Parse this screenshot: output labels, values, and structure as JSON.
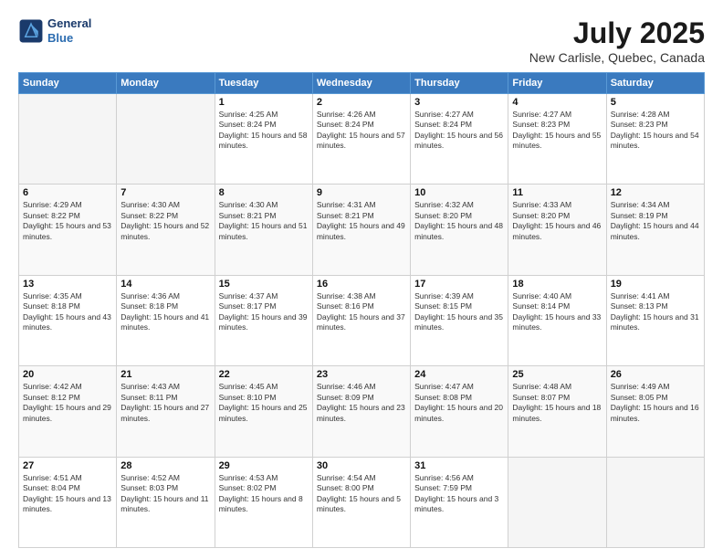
{
  "header": {
    "logo_line1": "General",
    "logo_line2": "Blue",
    "title": "July 2025",
    "subtitle": "New Carlisle, Quebec, Canada"
  },
  "weekdays": [
    "Sunday",
    "Monday",
    "Tuesday",
    "Wednesday",
    "Thursday",
    "Friday",
    "Saturday"
  ],
  "weeks": [
    [
      {
        "day": "",
        "info": ""
      },
      {
        "day": "",
        "info": ""
      },
      {
        "day": "1",
        "info": "Sunrise: 4:25 AM\nSunset: 8:24 PM\nDaylight: 15 hours and 58 minutes."
      },
      {
        "day": "2",
        "info": "Sunrise: 4:26 AM\nSunset: 8:24 PM\nDaylight: 15 hours and 57 minutes."
      },
      {
        "day": "3",
        "info": "Sunrise: 4:27 AM\nSunset: 8:24 PM\nDaylight: 15 hours and 56 minutes."
      },
      {
        "day": "4",
        "info": "Sunrise: 4:27 AM\nSunset: 8:23 PM\nDaylight: 15 hours and 55 minutes."
      },
      {
        "day": "5",
        "info": "Sunrise: 4:28 AM\nSunset: 8:23 PM\nDaylight: 15 hours and 54 minutes."
      }
    ],
    [
      {
        "day": "6",
        "info": "Sunrise: 4:29 AM\nSunset: 8:22 PM\nDaylight: 15 hours and 53 minutes."
      },
      {
        "day": "7",
        "info": "Sunrise: 4:30 AM\nSunset: 8:22 PM\nDaylight: 15 hours and 52 minutes."
      },
      {
        "day": "8",
        "info": "Sunrise: 4:30 AM\nSunset: 8:21 PM\nDaylight: 15 hours and 51 minutes."
      },
      {
        "day": "9",
        "info": "Sunrise: 4:31 AM\nSunset: 8:21 PM\nDaylight: 15 hours and 49 minutes."
      },
      {
        "day": "10",
        "info": "Sunrise: 4:32 AM\nSunset: 8:20 PM\nDaylight: 15 hours and 48 minutes."
      },
      {
        "day": "11",
        "info": "Sunrise: 4:33 AM\nSunset: 8:20 PM\nDaylight: 15 hours and 46 minutes."
      },
      {
        "day": "12",
        "info": "Sunrise: 4:34 AM\nSunset: 8:19 PM\nDaylight: 15 hours and 44 minutes."
      }
    ],
    [
      {
        "day": "13",
        "info": "Sunrise: 4:35 AM\nSunset: 8:18 PM\nDaylight: 15 hours and 43 minutes."
      },
      {
        "day": "14",
        "info": "Sunrise: 4:36 AM\nSunset: 8:18 PM\nDaylight: 15 hours and 41 minutes."
      },
      {
        "day": "15",
        "info": "Sunrise: 4:37 AM\nSunset: 8:17 PM\nDaylight: 15 hours and 39 minutes."
      },
      {
        "day": "16",
        "info": "Sunrise: 4:38 AM\nSunset: 8:16 PM\nDaylight: 15 hours and 37 minutes."
      },
      {
        "day": "17",
        "info": "Sunrise: 4:39 AM\nSunset: 8:15 PM\nDaylight: 15 hours and 35 minutes."
      },
      {
        "day": "18",
        "info": "Sunrise: 4:40 AM\nSunset: 8:14 PM\nDaylight: 15 hours and 33 minutes."
      },
      {
        "day": "19",
        "info": "Sunrise: 4:41 AM\nSunset: 8:13 PM\nDaylight: 15 hours and 31 minutes."
      }
    ],
    [
      {
        "day": "20",
        "info": "Sunrise: 4:42 AM\nSunset: 8:12 PM\nDaylight: 15 hours and 29 minutes."
      },
      {
        "day": "21",
        "info": "Sunrise: 4:43 AM\nSunset: 8:11 PM\nDaylight: 15 hours and 27 minutes."
      },
      {
        "day": "22",
        "info": "Sunrise: 4:45 AM\nSunset: 8:10 PM\nDaylight: 15 hours and 25 minutes."
      },
      {
        "day": "23",
        "info": "Sunrise: 4:46 AM\nSunset: 8:09 PM\nDaylight: 15 hours and 23 minutes."
      },
      {
        "day": "24",
        "info": "Sunrise: 4:47 AM\nSunset: 8:08 PM\nDaylight: 15 hours and 20 minutes."
      },
      {
        "day": "25",
        "info": "Sunrise: 4:48 AM\nSunset: 8:07 PM\nDaylight: 15 hours and 18 minutes."
      },
      {
        "day": "26",
        "info": "Sunrise: 4:49 AM\nSunset: 8:05 PM\nDaylight: 15 hours and 16 minutes."
      }
    ],
    [
      {
        "day": "27",
        "info": "Sunrise: 4:51 AM\nSunset: 8:04 PM\nDaylight: 15 hours and 13 minutes."
      },
      {
        "day": "28",
        "info": "Sunrise: 4:52 AM\nSunset: 8:03 PM\nDaylight: 15 hours and 11 minutes."
      },
      {
        "day": "29",
        "info": "Sunrise: 4:53 AM\nSunset: 8:02 PM\nDaylight: 15 hours and 8 minutes."
      },
      {
        "day": "30",
        "info": "Sunrise: 4:54 AM\nSunset: 8:00 PM\nDaylight: 15 hours and 5 minutes."
      },
      {
        "day": "31",
        "info": "Sunrise: 4:56 AM\nSunset: 7:59 PM\nDaylight: 15 hours and 3 minutes."
      },
      {
        "day": "",
        "info": ""
      },
      {
        "day": "",
        "info": ""
      }
    ]
  ]
}
